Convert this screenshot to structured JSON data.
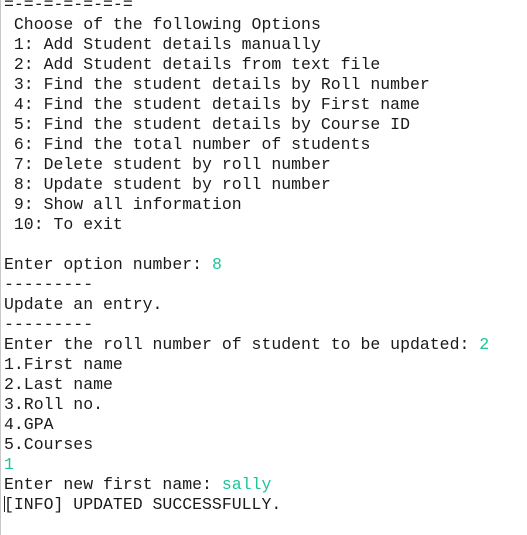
{
  "colors": {
    "text": "#1a1a1a",
    "input": "#1dc49a",
    "background": "#ffffff"
  },
  "lines": [
    {
      "text": "=-=-=-=-=-=-="
    },
    {
      "text": " Choose of the following Options"
    },
    {
      "text": " 1: Add Student details manually"
    },
    {
      "text": " 2: Add Student details from text file"
    },
    {
      "text": " 3: Find the student details by Roll number"
    },
    {
      "text": " 4: Find the student details by First name"
    },
    {
      "text": " 5: Find the student details by Course ID"
    },
    {
      "text": " 6: Find the total number of students"
    },
    {
      "text": " 7: Delete student by roll number"
    },
    {
      "text": " 8: Update student by roll number"
    },
    {
      "text": " 9: Show all information"
    },
    {
      "text": " 10: To exit"
    },
    {
      "text": ""
    },
    {
      "text": "Enter option number: ",
      "input": "8"
    },
    {
      "text": "---------"
    },
    {
      "text": "Update an entry."
    },
    {
      "text": "---------"
    },
    {
      "text": "Enter the roll number of student to be updated: ",
      "input": "2"
    },
    {
      "text": "1.First name"
    },
    {
      "text": "2.Last name"
    },
    {
      "text": "3.Roll no."
    },
    {
      "text": "4.GPA"
    },
    {
      "text": "5.Courses"
    },
    {
      "text": "",
      "input": "1"
    },
    {
      "text": "Enter new first name: ",
      "input": "sally"
    },
    {
      "text": "[INFO] UPDATED SUCCESSFULLY.",
      "cursor": true
    }
  ]
}
